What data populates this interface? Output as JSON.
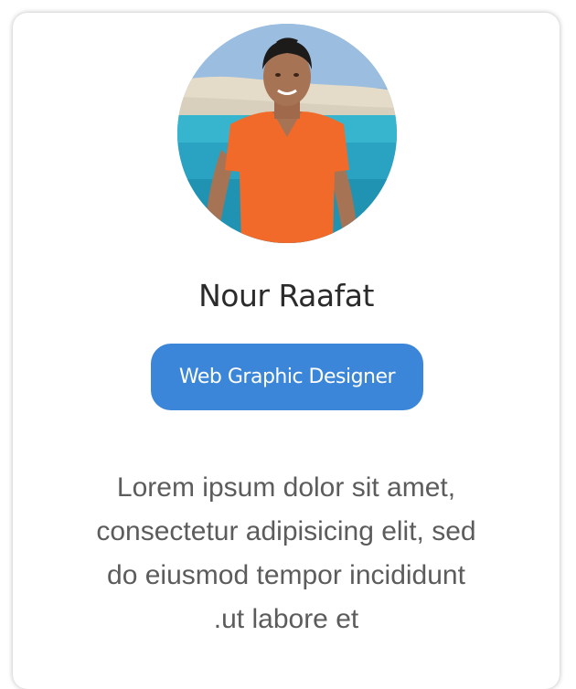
{
  "profile": {
    "avatar_alt": "profile photo",
    "name": "Nour Raafat",
    "role": "Web Graphic Designer",
    "bio_lines": [
      "Lorem ipsum dolor sit amet,",
      "consectetur adipisicing elit, sed",
      "do eiusmod tempor incididunt",
      ".ut labore et"
    ]
  },
  "colors": {
    "accent": "#3b86d8",
    "name_text": "#2b2b2b",
    "bio_text": "#5c5c5c"
  }
}
